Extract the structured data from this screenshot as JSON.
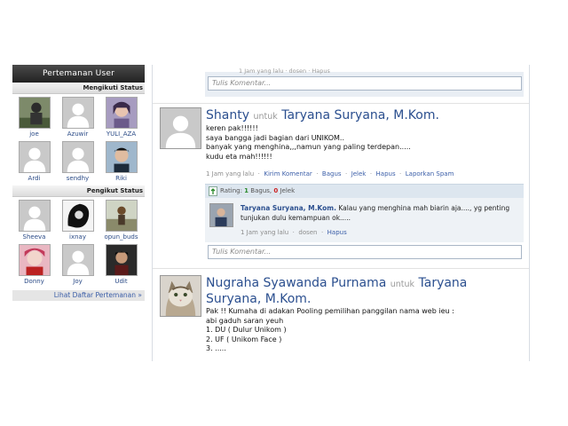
{
  "sidebar": {
    "title": "Pertemanan User",
    "following_label": "Mengikuti Status",
    "following": [
      {
        "name": "joe",
        "avatar": "photo"
      },
      {
        "name": "Azuwir",
        "avatar": "default"
      },
      {
        "name": "YULI_AZA",
        "avatar": "photo"
      },
      {
        "name": "Ardi",
        "avatar": "default"
      },
      {
        "name": "sendhy",
        "avatar": "default"
      },
      {
        "name": "Riki",
        "avatar": "photo"
      }
    ],
    "followers_label": "Pengikut Status",
    "followers": [
      {
        "name": "Sheeva",
        "avatar": "default"
      },
      {
        "name": "ixnay",
        "avatar": "photo"
      },
      {
        "name": "opun_buds",
        "avatar": "photo"
      },
      {
        "name": "Donny",
        "avatar": "photo"
      },
      {
        "name": "Joy",
        "avatar": "default"
      },
      {
        "name": "Udit",
        "avatar": "photo"
      }
    ],
    "see_all": "Lihat Daftar Pertemanan »"
  },
  "feed": {
    "top_cutoff": "1 Jam yang lalu · dosen · Hapus",
    "comment_placeholder": "Tulis Komentar...",
    "post1": {
      "author": "Shanty",
      "untuk": "untuk",
      "target": "Taryana Suryana, M.Kom.",
      "body": "keren pak!!!!!!\nsaya bangga jadi bagian dari UNIKOM..\nbanyak yang menghina,,,namun yang paling terdepan.....\nkudu eta mah!!!!!!",
      "time": "1 Jam yang lalu",
      "actions": [
        "Kirim Komentar",
        "Bagus",
        "Jelek",
        "Hapus",
        "Laporkan Spam"
      ],
      "rating_label": "Rating:",
      "rating_good": "1",
      "rating_good_label": "Bagus,",
      "rating_bad": "0",
      "rating_bad_label": "Jelek",
      "reply": {
        "author": "Taryana Suryana, M.Kom.",
        "text": "Kalau yang menghina mah biarin aja...., yg penting tunjukan dulu kemampuan ok.....",
        "time": "1 Jam yang lalu",
        "role": "dosen",
        "delete": "Hapus"
      }
    },
    "post2": {
      "author": "Nugraha Syawanda Purnama",
      "untuk": "untuk",
      "target": "Taryana Suryana, M.Kom.",
      "body": "Pak !! Kumaha di adakan Pooling pemilihan panggilan nama web ieu :\nabi gaduh saran yeuh\n1. DU ( Dulur Unikom )\n2. UF ( Unikom Face )\n3. ....."
    }
  },
  "colors": {
    "link": "#2b4f8f",
    "header_dark": "#2b2b2b",
    "rating_green": "#2a8a2a",
    "rating_red": "#cc2222"
  }
}
